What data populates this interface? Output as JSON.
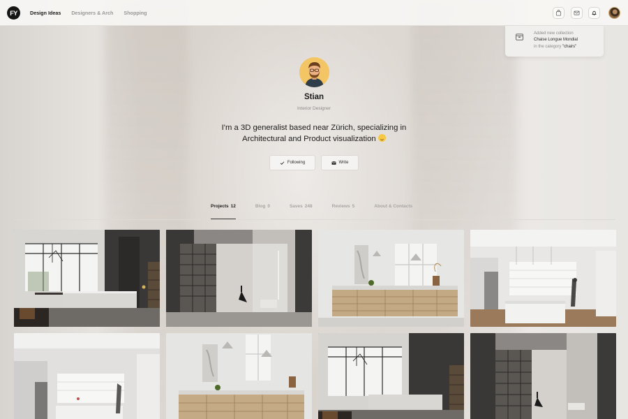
{
  "header": {
    "logo": "FY",
    "nav": [
      "Design Ideas",
      "Designers & Arch",
      "Shopping"
    ],
    "active_nav": 0
  },
  "icons": {
    "bag": "shopping-bag-icon",
    "mail": "mail-icon",
    "bell": "bell-icon",
    "check": "checkmark-icon",
    "envelope": "envelope-icon",
    "collection": "collection-icon"
  },
  "notification": {
    "line1": "Added new collection",
    "line2": "Chaise Longue Mondial",
    "line3_prefix": "in the category ",
    "line3_value": "\"chairs\""
  },
  "profile": {
    "name": "Stian",
    "role": "Interior Designer",
    "bio": "I'm a 3D generalist based near Zürich, specializing in Architectural and Product visualization"
  },
  "actions": {
    "following": "Following",
    "write": "Write"
  },
  "tabs": [
    {
      "label": "Projects",
      "count": "12"
    },
    {
      "label": "Blog",
      "count": "0"
    },
    {
      "label": "Saves",
      "count": "248"
    },
    {
      "label": "Reviews",
      "count": "5"
    },
    {
      "label": "About & Contacts",
      "count": ""
    }
  ],
  "colors": {
    "accent": "#1c1c1c",
    "muted": "#9a9896",
    "avatar_bg": "#f4c565"
  }
}
